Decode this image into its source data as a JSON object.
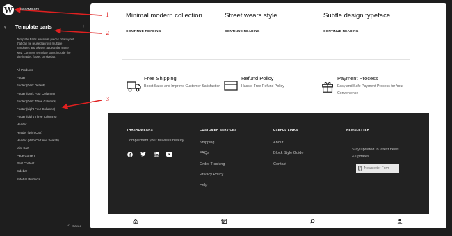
{
  "app": {
    "site_name": "Threadwears"
  },
  "sidebar": {
    "title": "Template parts",
    "description": "Template Parts are small pieces of a layout that can be reused across multiple templates and always appear the same way. Common template parts include the site header, footer, or sidebar.",
    "items": [
      "All Products",
      "Footer",
      "Footer (Dark Default)",
      "Footer (Dark Four Columns)",
      "Footer (Dark Three Columns)",
      "Footer (Light Four Columns)",
      "Footer (Light Three Columns)",
      "Header",
      "Header (With Cart)",
      "Header (With Cart And Search)",
      "Mini Cart",
      "Page Content",
      "Post Content",
      "Sidebar",
      "Sidebar Products"
    ],
    "saved_label": "Saved"
  },
  "posts": [
    {
      "title": "Minimal modern collection",
      "link": "CONTINUE READING"
    },
    {
      "title": "Street wears style",
      "link": "CONTINUE READING"
    },
    {
      "title": "Subtle design typeface",
      "link": "CONTINUE READING"
    }
  ],
  "features": [
    {
      "icon": "truck-icon",
      "title": "Free Shipping",
      "desc": "Boost Sales and Improve Customer Satisfaction"
    },
    {
      "icon": "card-icon",
      "title": "Refund Policy",
      "desc": "Hassle-Free Refund Policy"
    },
    {
      "icon": "gift-icon",
      "title": "Payment Process",
      "desc": "Easy and Safe Payment Process for Your Convenience"
    }
  ],
  "footer": {
    "brand": {
      "heading": "THREADWEARS",
      "text": "Complement your flawless beauty."
    },
    "customer": {
      "heading": "CUSTOMER SERVICES",
      "links": [
        "Shipping",
        "FAQs",
        "Order Tracking",
        "Privacy Policy",
        "Help"
      ]
    },
    "useful": {
      "heading": "USEFUL LINKS",
      "links": [
        "About",
        "Block Style Guide",
        "Contact"
      ]
    },
    "newsletter": {
      "heading": "NEWSLETTER",
      "text": "Stay updated to latest news & updates.",
      "form_label": "Newsletter Form",
      "form_icon": "[/]"
    }
  },
  "annotations": {
    "n1": "1",
    "n2": "2",
    "n3": "3"
  }
}
